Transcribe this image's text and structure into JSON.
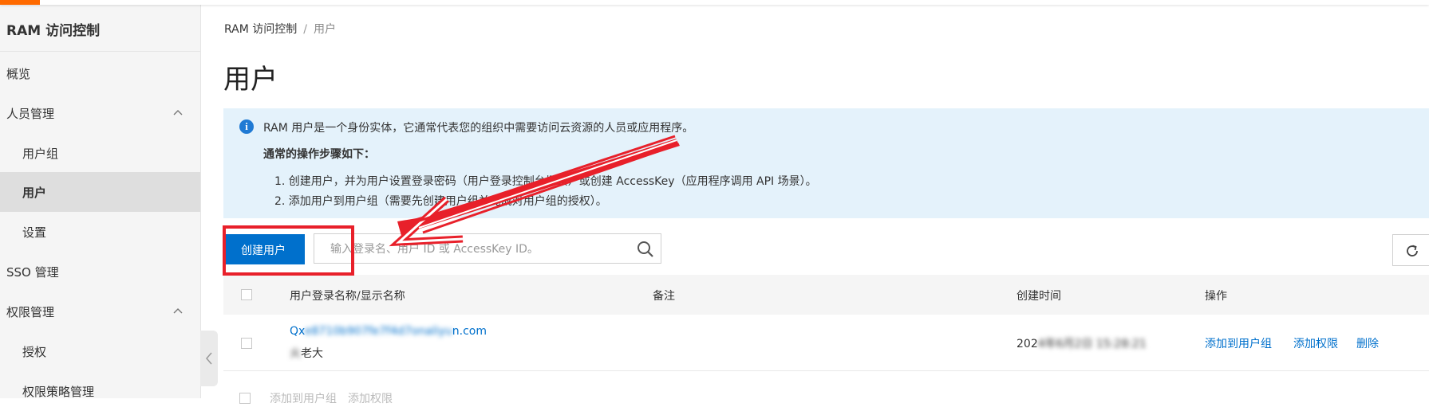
{
  "sidebar": {
    "title": "RAM 访问控制",
    "items": [
      {
        "label": "概览",
        "level": "top"
      },
      {
        "label": "人员管理",
        "level": "top",
        "expanded": true
      },
      {
        "label": "用户组",
        "level": "sub"
      },
      {
        "label": "用户",
        "level": "sub",
        "active": true
      },
      {
        "label": "设置",
        "level": "sub"
      },
      {
        "label": "SSO 管理",
        "level": "top"
      },
      {
        "label": "权限管理",
        "level": "top",
        "expanded": true
      },
      {
        "label": "授权",
        "level": "sub"
      },
      {
        "label": "权限策略管理",
        "level": "sub"
      }
    ]
  },
  "breadcrumb": {
    "root": "RAM 访问控制",
    "separator": "/",
    "current": "用户"
  },
  "page": {
    "title": "用户"
  },
  "info": {
    "icon": "info-icon",
    "intro": "RAM 用户是一个身份实体，它通常代表您的组织中需要访问云资源的人员或应用程序。",
    "steps_title": "通常的操作步骤如下：",
    "step1": "1. 创建用户，并为用户设置登录密码（用户登录控制台场景）或创建 AccessKey（应用程序调用 API 场景）。",
    "step2": "2. 添加用户到用户组（需要先创建用户组并完成对用户组的授权）。"
  },
  "toolbar": {
    "create_label": "创建用户",
    "search_placeholder": "输入登录名、用户 ID 或 AccessKey ID。",
    "search_value": ""
  },
  "table": {
    "columns": {
      "name": "用户登录名称/显示名称",
      "note": "备注",
      "created": "创建时间",
      "actions": "操作"
    },
    "rows": [
      {
        "login_prefix": "Qx",
        "login_hidden": "e8710b907fe7f4d7onaliyu",
        "login_suffix": "n.com",
        "display_hidden": "火",
        "display_suffix": "老大",
        "note": "",
        "created_prefix": "202",
        "created_hidden": "4年6月2日 15:28:21",
        "actions": [
          "添加到用户组",
          "添加权限",
          "删除"
        ]
      }
    ]
  },
  "footer_actions": {
    "add_to_group": "添加到用户组",
    "add_permission": "添加权限"
  },
  "colors": {
    "primary": "#0070cc",
    "info_bg": "#e4f2fb",
    "annotation": "#e8202a",
    "brand": "#ff6a00"
  }
}
